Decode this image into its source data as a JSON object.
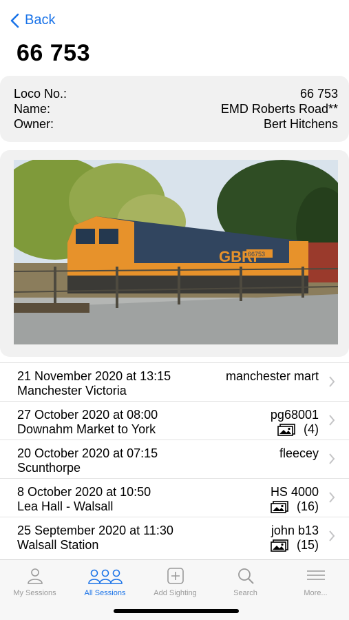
{
  "nav": {
    "back_label": "Back",
    "title": "66 753"
  },
  "info": {
    "rows": [
      {
        "label": "Loco No.:",
        "value": "66 753"
      },
      {
        "label": "Name:",
        "value": "EMD Roberts Road**"
      },
      {
        "label": "Owner:",
        "value": "Bert Hitchens"
      }
    ]
  },
  "photo": {
    "livery_text": "GBRf",
    "number_plate": "66753"
  },
  "sessions": [
    {
      "date": "21 November 2020 at 13:15",
      "place": "Manchester Victoria",
      "user": "manchester mart",
      "photo_count": ""
    },
    {
      "date": "27 October 2020 at 08:00",
      "place": "Downahm Market to York",
      "user": "pg68001",
      "photo_count": "(4)"
    },
    {
      "date": "20 October 2020 at 07:15",
      "place": "Scunthorpe",
      "user": "fleecey",
      "photo_count": ""
    },
    {
      "date": "8 October 2020 at 10:50",
      "place": "Lea Hall - Walsall",
      "user": "HS 4000",
      "photo_count": "(16)"
    },
    {
      "date": "25 September 2020 at 11:30",
      "place": "Walsall Station",
      "user": "john  b13",
      "photo_count": "(15)"
    }
  ],
  "tabs": [
    {
      "label": "My Sessions",
      "icon": "person-icon"
    },
    {
      "label": "All Sessions",
      "icon": "people-icon"
    },
    {
      "label": "Add Sighting",
      "icon": "plus-square-icon"
    },
    {
      "label": "Search",
      "icon": "search-icon"
    },
    {
      "label": "More...",
      "icon": "menu-lines-icon"
    }
  ],
  "colors": {
    "accent": "#1a73e8",
    "inactive": "#9a9a9a",
    "card_bg": "#f1f1f1"
  }
}
